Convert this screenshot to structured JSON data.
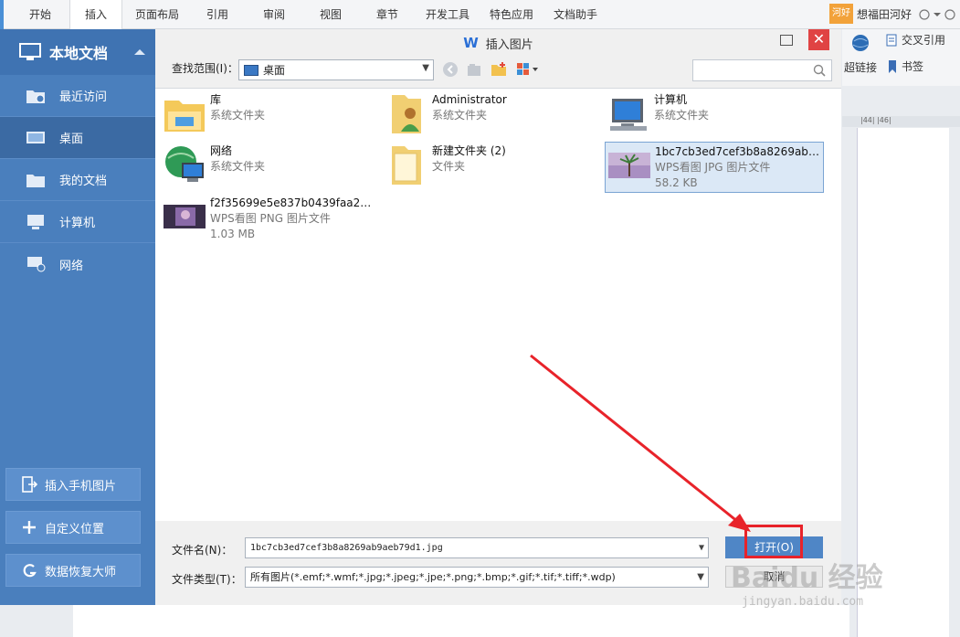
{
  "ribbon": {
    "tabs": [
      {
        "label": "开始"
      },
      {
        "label": "插入",
        "active": true
      },
      {
        "label": "页面布局"
      },
      {
        "label": "引用"
      },
      {
        "label": "审阅"
      },
      {
        "label": "视图"
      },
      {
        "label": "章节"
      },
      {
        "label": "开发工具"
      },
      {
        "label": "特色应用"
      },
      {
        "label": "文档助手"
      }
    ],
    "badge": "河好",
    "user": "想福田河好"
  },
  "tools": {
    "cross_ref": "交叉引用",
    "hyperlink": "超链接",
    "bookmark": "书签",
    "ruler": "|44|  |46|"
  },
  "left_panel": {
    "title": "本地文档",
    "items": [
      {
        "label": "最近访问",
        "icon": "recent-folder-icon"
      },
      {
        "label": "桌面",
        "icon": "desktop-icon",
        "active": true
      },
      {
        "label": "我的文档",
        "icon": "folder-icon"
      },
      {
        "label": "计算机",
        "icon": "computer-icon"
      },
      {
        "label": "网络",
        "icon": "network-icon"
      }
    ],
    "buttons": [
      {
        "label": "插入手机图片",
        "icon": "phone-import-icon"
      },
      {
        "label": "自定义位置",
        "icon": "plus-icon"
      },
      {
        "label": "数据恢复大师",
        "icon": "recovery-icon"
      }
    ]
  },
  "dialog": {
    "title": "插入图片",
    "look_in_label": "查找范围(I)：",
    "look_in_value": "桌面",
    "files": [
      {
        "name": "库",
        "type": "系统文件夹",
        "size": "",
        "icon": "library-folder-icon"
      },
      {
        "name": "Administrator",
        "type": "系统文件夹",
        "size": "",
        "icon": "user-folder-icon"
      },
      {
        "name": "计算机",
        "type": "系统文件夹",
        "size": "",
        "icon": "computer-icon"
      },
      {
        "name": "网络",
        "type": "系统文件夹",
        "size": "",
        "icon": "network-globe-icon"
      },
      {
        "name": "新建文件夹 (2)",
        "type": "文件夹",
        "size": "",
        "icon": "folder-icon"
      },
      {
        "name": "1bc7cb3ed7cef3b8a8269ab9...",
        "type": "WPS看图 JPG 图片文件",
        "size": "58.2 KB",
        "icon": "jpg-thumbnail-icon",
        "selected": true
      },
      {
        "name": "f2f35699e5e837b0439faa2e2...",
        "type": "WPS看图 PNG 图片文件",
        "size": "1.03 MB",
        "icon": "png-thumbnail-icon"
      }
    ],
    "filename_label": "文件名(N)：",
    "filename_value": "1bc7cb3ed7cef3b8a8269ab9aeb79d1.jpg",
    "filetype_label": "文件类型(T)：",
    "filetype_value": "所有图片(*.emf;*.wmf;*.jpg;*.jpeg;*.jpe;*.png;*.bmp;*.gif;*.tif;*.tiff;*.wdp)",
    "open_label": "打开(O)",
    "cancel_label": "取消"
  },
  "watermark": {
    "brand": "Baidu 经验",
    "url": "jingyan.baidu.com"
  },
  "colors": {
    "left_panel": "#4a7fbd",
    "accent": "#2a6fd6",
    "highlight": "#e8232a",
    "close": "#e04343"
  }
}
